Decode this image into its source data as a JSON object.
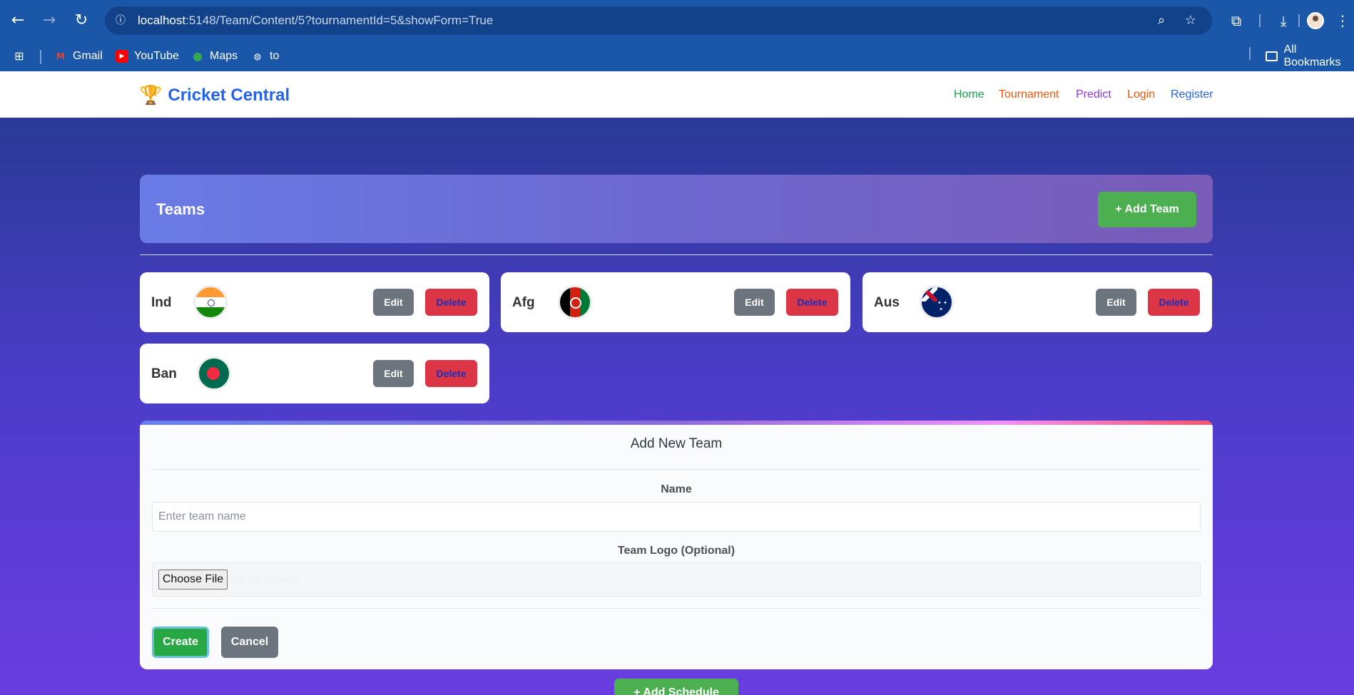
{
  "browser": {
    "url_host": "localhost",
    "url_rest": ":5148/Team/Content/5?tournamentId=5&showForm=True",
    "bookmarks": [
      {
        "label": "Gmail",
        "icon": "gmail-icon"
      },
      {
        "label": "YouTube",
        "icon": "youtube-icon"
      },
      {
        "label": "Maps",
        "icon": "maps-icon"
      },
      {
        "label": "to",
        "icon": "globe-icon"
      }
    ],
    "all_bookmarks": "All Bookmarks"
  },
  "site": {
    "brand": "Cricket Central",
    "nav": [
      {
        "label": "Home",
        "color": "#16a34a"
      },
      {
        "label": "Tournament",
        "color": "#ea580c"
      },
      {
        "label": "Predict",
        "color": "#9333ea"
      },
      {
        "label": "Login",
        "color": "#ea580c"
      },
      {
        "label": "Register",
        "color": "#2563eb"
      }
    ]
  },
  "teams_section": {
    "title": "Teams",
    "add_button": "+ Add Team",
    "teams": [
      {
        "name": "Ind",
        "flag": "india-flag-icon"
      },
      {
        "name": "Afg",
        "flag": "afghanistan-flag-icon"
      },
      {
        "name": "Aus",
        "flag": "australia-flag-icon"
      },
      {
        "name": "Ban",
        "flag": "bangladesh-flag-icon"
      }
    ],
    "edit_label": "Edit",
    "delete_label": "Delete"
  },
  "form": {
    "title": "Add New Team",
    "name_label": "Name",
    "name_placeholder": "Enter team name",
    "logo_label": "Team Logo (Optional)",
    "choose_file": "Choose File",
    "no_file": "No file chosen",
    "create": "Create",
    "cancel": "Cancel"
  },
  "add_schedule": "+ Add Schedule"
}
